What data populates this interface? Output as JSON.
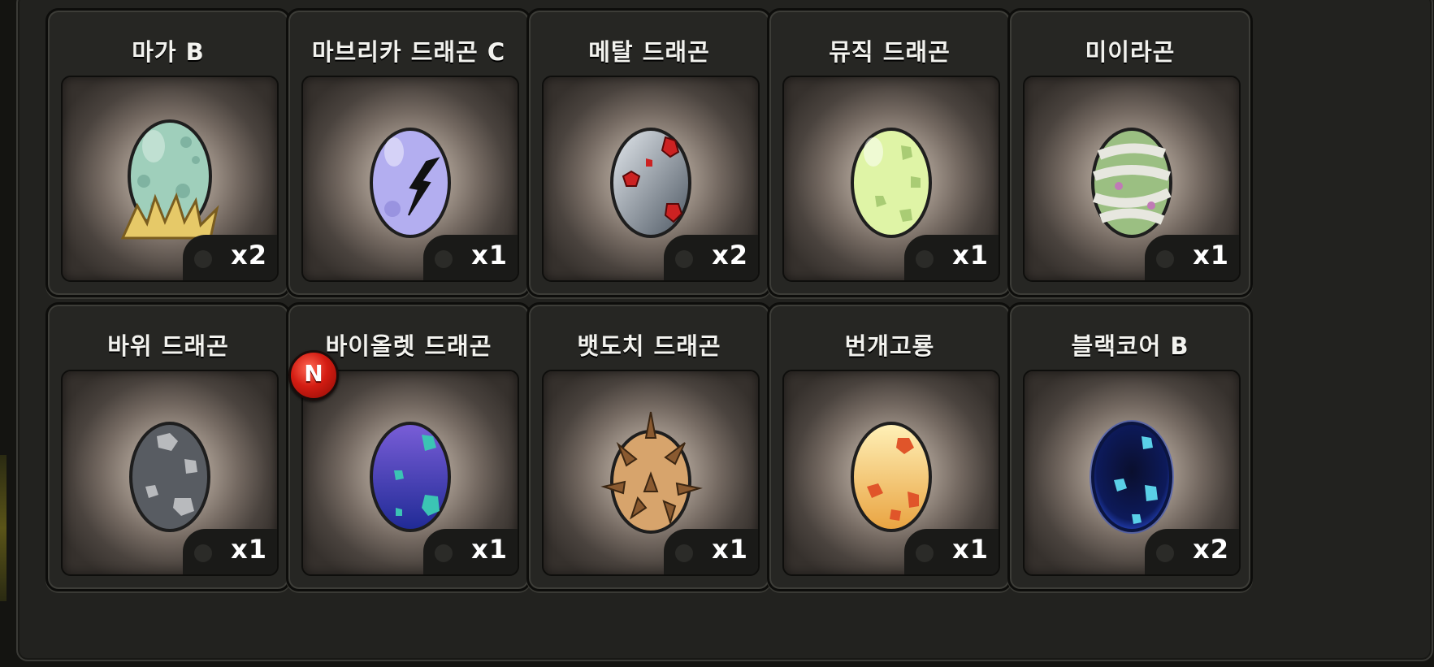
{
  "items": [
    {
      "name": "마가 B",
      "qty": "x2",
      "egg_icon": "grass-nest-egg-icon",
      "colors": {
        "base": "#9fcfbb",
        "spot": "#7fb3a1",
        "dark": "#5f8d7e"
      }
    },
    {
      "name": "마브리카 드래곤 C",
      "qty": "x1",
      "egg_icon": "cracked-egg-icon",
      "colors": {
        "base": "#b3aef0",
        "spot": "#8e87d8",
        "dark": "#6e67b5"
      }
    },
    {
      "name": "메탈 드래곤",
      "qty": "x2",
      "egg_icon": "metal-egg-icon",
      "colors": {
        "base": "#c4ccd4",
        "spot": "#cc2222",
        "dark": "#5b6570"
      }
    },
    {
      "name": "뮤직 드래곤",
      "qty": "x1",
      "egg_icon": "music-egg-icon",
      "colors": {
        "base": "#dff4a6",
        "spot": "#a9cc74",
        "dark": "#8aa85c"
      }
    },
    {
      "name": "미이라곤",
      "qty": "x1",
      "egg_icon": "mummy-egg-icon",
      "colors": {
        "base": "#9bbf82",
        "spot": "#e7e7df",
        "dark": "#c07ab6"
      }
    },
    {
      "name": "바위 드래곤",
      "qty": "x1",
      "egg_icon": "rock-egg-icon",
      "colors": {
        "base": "#585c62",
        "spot": "#b8babd",
        "dark": "#3e4145"
      }
    },
    {
      "name": "바이올렛 드래곤",
      "qty": "x1",
      "egg_icon": "violet-egg-icon",
      "colors": {
        "base": "#5b48c9",
        "spot": "#3bc4b4",
        "dark": "#1f2a95"
      },
      "is_new": true,
      "new_label": "N"
    },
    {
      "name": "뱃도치 드래곤",
      "qty": "x1",
      "egg_icon": "spiky-egg-icon",
      "colors": {
        "base": "#d7a46c",
        "spot": "#8a5a30",
        "dark": "#6d4726"
      }
    },
    {
      "name": "번개고룡",
      "qty": "x1",
      "egg_icon": "lightning-egg-icon",
      "colors": {
        "base": "#fbd36e",
        "spot": "#e0552a",
        "dark": "#e9a340"
      }
    },
    {
      "name": "블랙코어 B",
      "qty": "x2",
      "egg_icon": "blackcore-egg-icon",
      "colors": {
        "base": "#0a0f2e",
        "spot": "#5ad0e8",
        "dark": "#2a4dd6"
      }
    }
  ]
}
